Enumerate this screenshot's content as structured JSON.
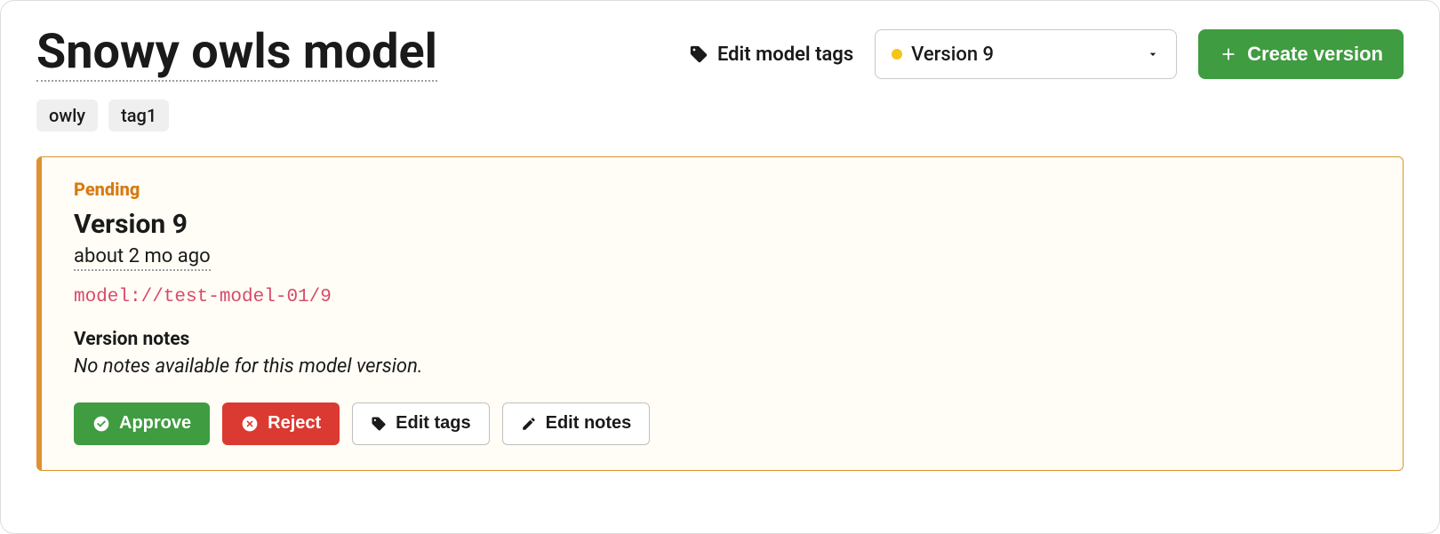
{
  "header": {
    "title": "Snowy owls model",
    "edit_tags_label": "Edit model tags",
    "create_version_label": "Create version"
  },
  "version_select": {
    "selected": "Version 9",
    "status_color": "#f5c518"
  },
  "tags": [
    "owly",
    "tag1"
  ],
  "card": {
    "status": "Pending",
    "version_title": "Version 9",
    "timestamp": "about 2 mo ago",
    "uri": "model://test-model-01/9",
    "notes_label": "Version notes",
    "notes_body": "No notes available for this model version.",
    "actions": {
      "approve": "Approve",
      "reject": "Reject",
      "edit_tags": "Edit tags",
      "edit_notes": "Edit notes"
    }
  }
}
